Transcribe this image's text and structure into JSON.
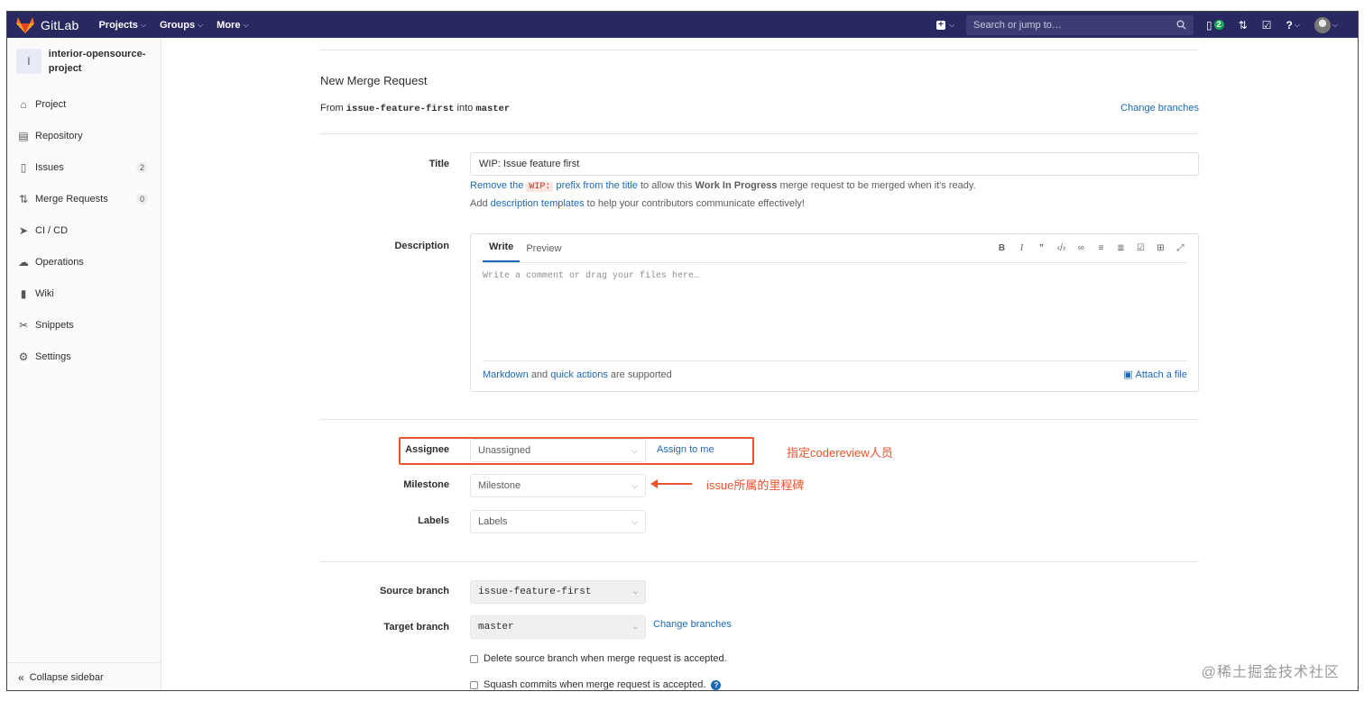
{
  "navbar": {
    "brand": "GitLab",
    "menu": [
      {
        "label": "Projects"
      },
      {
        "label": "Groups"
      },
      {
        "label": "More"
      }
    ],
    "search_placeholder": "Search or jump to…",
    "issues_count": "2"
  },
  "sidebar": {
    "project_initial": "I",
    "project_name": "interior-opensource-project",
    "items": [
      {
        "label": "Project",
        "icon": "home-icon"
      },
      {
        "label": "Repository",
        "icon": "document-icon"
      },
      {
        "label": "Issues",
        "icon": "issues-icon",
        "count": "2"
      },
      {
        "label": "Merge Requests",
        "icon": "merge-request-icon",
        "count": "0"
      },
      {
        "label": "CI / CD",
        "icon": "rocket-icon"
      },
      {
        "label": "Operations",
        "icon": "cloud-icon"
      },
      {
        "label": "Wiki",
        "icon": "book-icon"
      },
      {
        "label": "Snippets",
        "icon": "scissors-icon"
      },
      {
        "label": "Settings",
        "icon": "gear-icon"
      }
    ],
    "collapse_label": "Collapse sidebar"
  },
  "main": {
    "page_title": "New Merge Request",
    "from_label": "From",
    "source_branch": "issue-feature-first",
    "into_label": "into",
    "target_branch": "master",
    "change_branches": "Change branches",
    "title_label": "Title",
    "title_value": "WIP: Issue feature first",
    "wip_hint": {
      "remove_the": "Remove the",
      "wip_code": "WIP:",
      "prefix_from_title": "prefix from the title",
      "rest1": "to allow this",
      "wip_bold": "Work In Progress",
      "rest2": "merge request to be merged when it's ready."
    },
    "templates_hint": {
      "add": "Add",
      "link": "description templates",
      "rest": "to help your contributors communicate effectively!"
    },
    "description_label": "Description",
    "tab_write": "Write",
    "tab_preview": "Preview",
    "textarea_placeholder": "Write a comment or drag your files here…",
    "footer": {
      "markdown": "Markdown",
      "and": "and",
      "quick_actions": "quick actions",
      "supported": "are supported",
      "attach": "Attach a file"
    },
    "assignee_label": "Assignee",
    "assignee_value": "Unassigned",
    "assign_to_me": "Assign to me",
    "milestone_label": "Milestone",
    "milestone_value": "Milestone",
    "labels_label": "Labels",
    "labels_value": "Labels",
    "source_branch_label": "Source branch",
    "source_branch_value": "issue-feature-first",
    "target_branch_label": "Target branch",
    "target_branch_value": "master",
    "delete_source": "Delete source branch when merge request is accepted.",
    "squash_commits": "Squash commits when merge request is accepted."
  },
  "annotations": {
    "assignee_note": "指定codereview人员",
    "milestone_note": "issue所属的里程碑",
    "color": "#e8542b"
  },
  "watermark": "@稀土掘金技术社区",
  "colors": {
    "navbar": "#292961",
    "link": "#1b69b6"
  }
}
